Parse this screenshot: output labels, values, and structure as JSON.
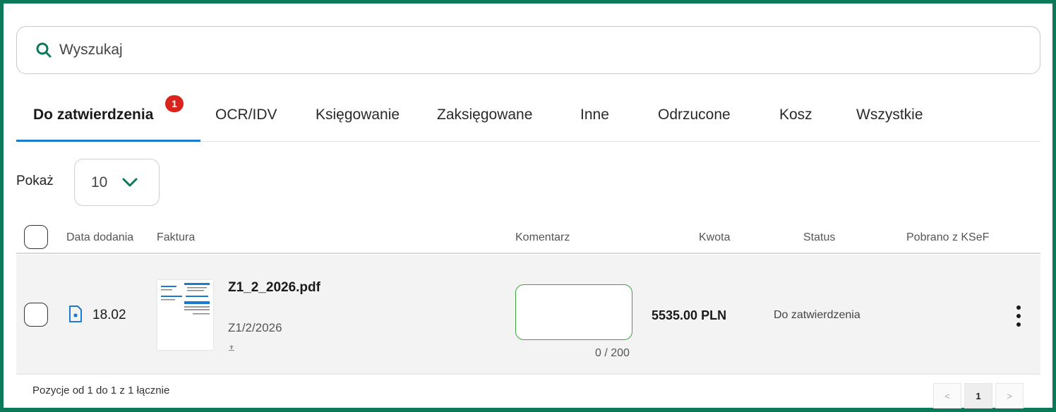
{
  "search": {
    "placeholder": "Wyszukaj"
  },
  "tabs": [
    {
      "label": "Do zatwierdzenia",
      "badge": "1"
    },
    {
      "label": "OCR/IDV"
    },
    {
      "label": "Księgowanie"
    },
    {
      "label": "Zaksięgowane"
    },
    {
      "label": "Inne"
    },
    {
      "label": "Odrzucone"
    },
    {
      "label": "Kosz"
    },
    {
      "label": "Wszystkie"
    }
  ],
  "page_size": {
    "label": "Pokaż",
    "value": "10"
  },
  "table": {
    "headers": [
      "Data dodania",
      "Faktura",
      "Komentarz",
      "Kwota",
      "Status",
      "Pobrano z KSeF"
    ],
    "rows": [
      {
        "date": "18.02",
        "file_name": "Z1_2_2026.pdf",
        "invoice_number": "Z1/2/2026",
        "comment_counter": "0 / 200",
        "amount": "5535.00 PLN",
        "status": "Do zatwierdzenia"
      }
    ]
  },
  "footer": {
    "summary": "Pozycje od 1 do 1 z 1 łącznie",
    "current_page": "1",
    "prev": "<",
    "next": ">"
  },
  "colors": {
    "accent": "#1b7bd1",
    "brand": "#0a7a5a",
    "badge": "#d8241c",
    "comment_border": "#3aa33a"
  }
}
